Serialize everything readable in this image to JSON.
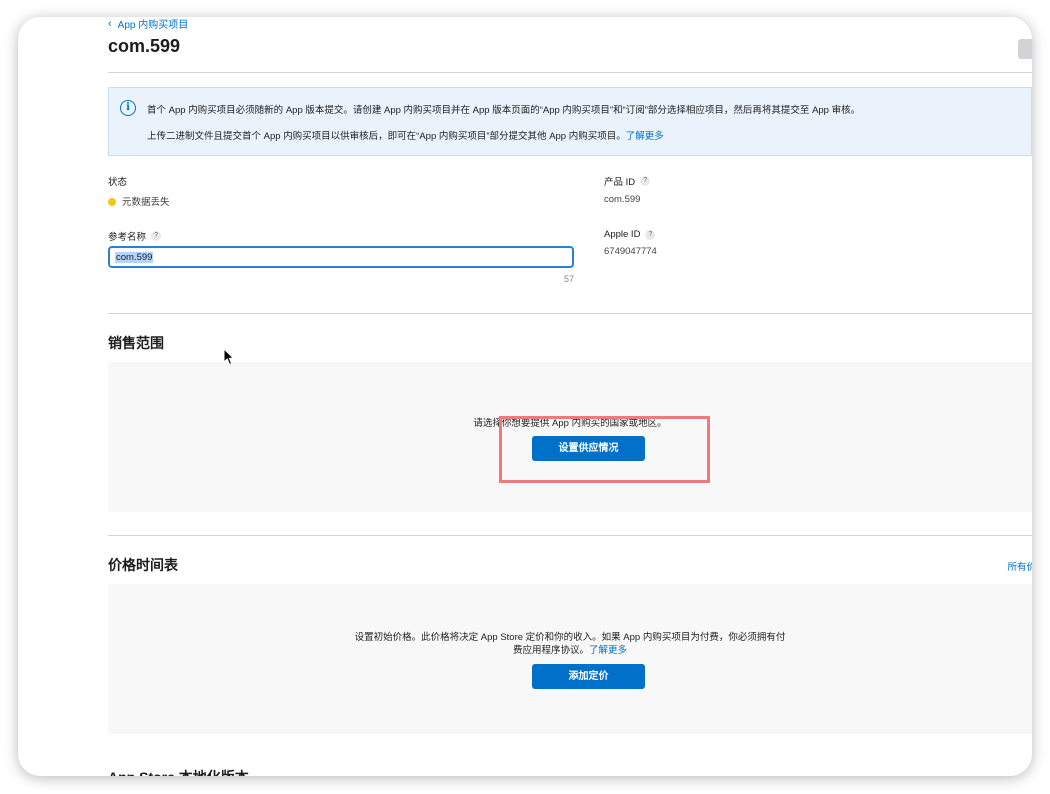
{
  "breadcrumb": {
    "back_label": "App 内购买项目"
  },
  "page": {
    "title": "com.599"
  },
  "notice": {
    "line1": "首个 App 内购买项目必须随新的 App 版本提交。请创建 App 内购买项目并在 App 版本页面的“App 内购买项目”和“订阅”部分选择相应项目，然后再将其提交至 App 审核。",
    "line2": "上传二进制文件且提交首个 App 内购买项目以供审核后，即可在“App 内购买项目”部分提交其他 App 内购买项目。",
    "learn_more": "了解更多"
  },
  "fields": {
    "status_label": "状态",
    "status_value": "元数据丢失",
    "product_id_label": "产品 ID",
    "product_id_value": "com.599",
    "ref_name_label": "参考名称",
    "ref_name_value": "com.599",
    "ref_name_remaining": "57",
    "apple_id_label": "Apple ID",
    "apple_id_value": "6749047774",
    "help_glyph": "?"
  },
  "availability": {
    "title": "销售范围",
    "message": "请选择你想要提供 App 内购买的国家或地区。",
    "button_label": "设置供应情况"
  },
  "pricing": {
    "title": "价格时间表",
    "all_prices_link": "所有价",
    "message_line1": "设置初始价格。此价格将决定 App Store 定价和你的收入。如果 App 内购买项目为付费，你必须拥有付",
    "message_line2": "费应用程序协议。",
    "learn_more": "了解更多",
    "button_label": "添加定价"
  },
  "localization": {
    "title_partial": "App Store 本地化版本"
  },
  "colors": {
    "accent": "#0070c9",
    "status_warning": "#f5c518",
    "highlight": "#ef7a7a"
  }
}
